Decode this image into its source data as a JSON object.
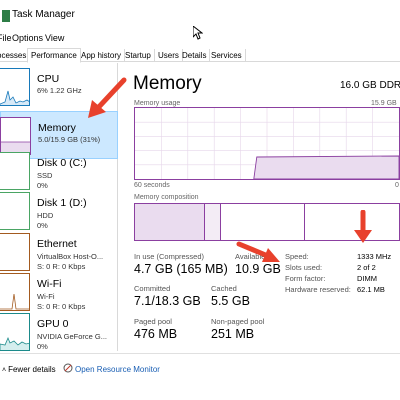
{
  "window": {
    "title": "Task Manager"
  },
  "menu": [
    "File",
    "Options",
    "View"
  ],
  "tabs": [
    "Processes",
    "Performance",
    "App history",
    "Startup",
    "Users",
    "Details",
    "Services"
  ],
  "active_tab": "Performance",
  "sidebar": [
    {
      "title": "CPU",
      "sub1": "6% 1.22 GHz",
      "sub2": ""
    },
    {
      "title": "Memory",
      "sub1": "5.0/15.9 GB (31%)",
      "sub2": ""
    },
    {
      "title": "Disk 0 (C:)",
      "sub1": "SSD",
      "sub2": "0%"
    },
    {
      "title": "Disk 1 (D:)",
      "sub1": "HDD",
      "sub2": "0%"
    },
    {
      "title": "Ethernet",
      "sub1": "VirtualBox Host-O...",
      "sub2": "S: 0 R: 0 Kbps"
    },
    {
      "title": "Wi-Fi",
      "sub1": "Wi-Fi",
      "sub2": "S: 0 R: 0 Kbps"
    },
    {
      "title": "GPU 0",
      "sub1": "NVIDIA GeForce G...",
      "sub2": "0%"
    }
  ],
  "main": {
    "title": "Memory",
    "total": "16.0 GB DDR3",
    "usage_label": "Memory usage",
    "usage_max": "15.9 GB",
    "time_left": "60 seconds",
    "time_right": "0",
    "composition_label": "Memory composition",
    "usage_fraction": 0.31
  },
  "stats": {
    "in_use_label": "In use (Compressed)",
    "in_use_value": "4.7 GB (165 MB)",
    "available_label": "Available",
    "available_value": "10.9 GB",
    "committed_label": "Committed",
    "committed_value": "7.1/18.3 GB",
    "cached_label": "Cached",
    "cached_value": "5.5 GB",
    "paged_label": "Paged pool",
    "paged_value": "476 MB",
    "nonpaged_label": "Non-paged pool",
    "nonpaged_value": "251 MB"
  },
  "specs": {
    "speed_label": "Speed:",
    "speed_value": "1333 MHz",
    "slots_label": "Slots used:",
    "slots_value": "2 of 2",
    "form_label": "Form factor:",
    "form_value": "DIMM",
    "reserved_label": "Hardware reserved:",
    "reserved_value": "62.1 MB"
  },
  "footer": {
    "fewer_details": "Fewer details",
    "open_monitor": "Open Resource Monitor"
  },
  "colors": {
    "memory_accent": "#8b3fa0",
    "cpu_accent": "#1779ba",
    "disk_accent": "#4aa564",
    "selection": "#cce8ff",
    "annotation_arrow": "#e8412c"
  },
  "icons": [
    "task-manager-icon",
    "cursor-icon",
    "chevron-up-icon",
    "resource-monitor-icon",
    "annotation-arrow"
  ]
}
